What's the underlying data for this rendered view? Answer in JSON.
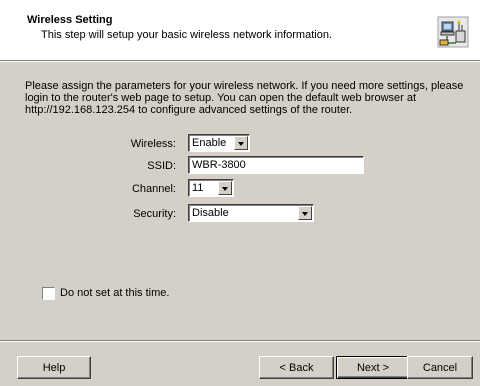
{
  "header": {
    "title": "Wireless Setting",
    "subtitle": "This step will setup your basic wireless network information.",
    "icon": "network-computer-icon"
  },
  "intro_text": "Please assign the parameters for your wireless network. If you need more settings, please login to the router's web page to setup. You can open the default web browser at http://192.168.123.254 to configure advanced settings of the router.",
  "form": {
    "wireless": {
      "label": "Wireless:",
      "value": "Enable"
    },
    "ssid": {
      "label": "SSID:",
      "value": "WBR-3800"
    },
    "channel": {
      "label": "Channel:",
      "value": "11"
    },
    "security": {
      "label": "Security:",
      "value": "Disable"
    }
  },
  "skip": {
    "label": "Do not set at this time.",
    "checked": false
  },
  "buttons": {
    "help": "Help",
    "back": "< Back",
    "next": "Next >",
    "cancel": "Cancel"
  }
}
